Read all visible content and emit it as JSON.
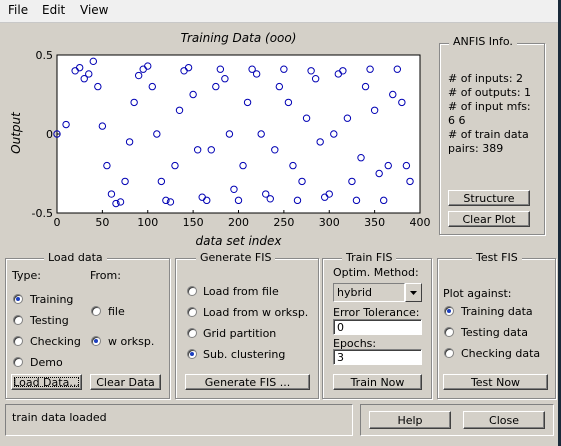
{
  "menu": {
    "file": "File",
    "edit": "Edit",
    "view": "View"
  },
  "plot": {
    "title": "Training Data (ooo)",
    "xlabel": "data set index",
    "ylabel": "Output"
  },
  "chart_data": {
    "type": "scatter",
    "title": "Training Data (ooo)",
    "xlabel": "data set index",
    "ylabel": "Output",
    "xlim": [
      0,
      400
    ],
    "ylim": [
      -0.5,
      0.5
    ],
    "xticks": [
      "0",
      "50",
      "100",
      "150",
      "200",
      "250",
      "300",
      "350",
      "400"
    ],
    "yticks": [
      "0.5",
      "0",
      "-0.5"
    ],
    "marker": "circle",
    "marker_color": "#0000b4",
    "n_points": 389,
    "series": [
      {
        "x": [
          0,
          10,
          20,
          25,
          30,
          35,
          40,
          45,
          50,
          55,
          60,
          65,
          70,
          75,
          80,
          85,
          90,
          95,
          100,
          105,
          110,
          115,
          120,
          125,
          130,
          135,
          140,
          145,
          150,
          155,
          160,
          165,
          170,
          175,
          180,
          185,
          190,
          195,
          200,
          205,
          210,
          215,
          220,
          225,
          230,
          235,
          240,
          245,
          250,
          255,
          260,
          265,
          270,
          275,
          280,
          285,
          290,
          295,
          300,
          305,
          310,
          315,
          320,
          325,
          330,
          335,
          340,
          345,
          350,
          355,
          360,
          365,
          370,
          375,
          380,
          385,
          389
        ],
        "y": [
          0.0,
          0.06,
          0.4,
          0.42,
          0.35,
          0.38,
          0.46,
          0.3,
          0.05,
          -0.2,
          -0.38,
          -0.44,
          -0.43,
          -0.3,
          -0.05,
          0.2,
          0.37,
          0.41,
          0.43,
          0.3,
          0.0,
          -0.3,
          -0.42,
          -0.43,
          -0.2,
          0.15,
          0.4,
          0.42,
          0.25,
          -0.1,
          -0.4,
          -0.42,
          -0.1,
          0.3,
          0.41,
          0.35,
          0.0,
          -0.35,
          -0.42,
          -0.2,
          0.2,
          0.41,
          0.38,
          0.0,
          -0.38,
          -0.41,
          -0.1,
          0.3,
          0.41,
          0.2,
          -0.2,
          -0.42,
          -0.3,
          0.1,
          0.4,
          0.35,
          -0.05,
          -0.4,
          -0.38,
          0.0,
          0.38,
          0.4,
          0.1,
          -0.3,
          -0.42,
          -0.15,
          0.3,
          0.41,
          0.15,
          -0.25,
          -0.42,
          -0.2,
          0.25,
          0.41,
          0.2,
          -0.2,
          -0.3
        ]
      }
    ]
  },
  "anfis": {
    "title": "ANFIS Info.",
    "inputs": "# of inputs: 2",
    "outputs": "# of outputs: 1",
    "input_mfs": "# of input mfs:",
    "mfs_values": "6  6",
    "train_pairs_1": "# of train data",
    "train_pairs_2": "pairs: 389",
    "structure_button": "Structure",
    "clear_plot_button": "Clear Plot"
  },
  "load_data": {
    "title": "Load data",
    "type_label": "Type:",
    "from_label": "From:",
    "types": [
      {
        "label": "Training",
        "selected": true
      },
      {
        "label": "Testing",
        "selected": false
      },
      {
        "label": "Checking",
        "selected": false
      },
      {
        "label": "Demo",
        "selected": false
      }
    ],
    "sources": [
      {
        "label": "file",
        "selected": false
      },
      {
        "label": "w orksp.",
        "selected": true
      }
    ],
    "load_button": "Load Data...",
    "clear_button": "Clear Data"
  },
  "generate_fis": {
    "title": "Generate FIS",
    "options": [
      {
        "label": "Load from file",
        "selected": false
      },
      {
        "label": "Load from w orksp.",
        "selected": false
      },
      {
        "label": "Grid partition",
        "selected": false
      },
      {
        "label": "Sub. clustering",
        "selected": true
      }
    ],
    "button": "Generate FIS ..."
  },
  "train_fis": {
    "title": "Train FIS",
    "method_label": "Optim. Method:",
    "method_value": "hybrid",
    "tolerance_label": "Error Tolerance:",
    "tolerance_value": "0",
    "epochs_label": "Epochs:",
    "epochs_value": "3",
    "button": "Train Now"
  },
  "test_fis": {
    "title": "Test FIS",
    "plot_against_label": "Plot against:",
    "options": [
      {
        "label": "Training data",
        "selected": true
      },
      {
        "label": "Testing data",
        "selected": false
      },
      {
        "label": "Checking data",
        "selected": false
      }
    ],
    "button": "Test Now"
  },
  "status": {
    "message": "train data loaded"
  },
  "footer": {
    "help_button": "Help",
    "close_button": "Close"
  }
}
